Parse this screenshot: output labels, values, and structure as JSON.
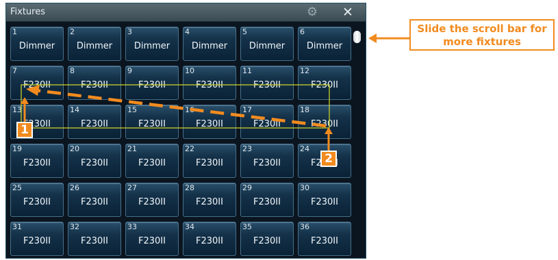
{
  "window": {
    "title": "Fixtures"
  },
  "fixtures": [
    {
      "num": "1",
      "label": "Dimmer"
    },
    {
      "num": "2",
      "label": "Dimmer"
    },
    {
      "num": "3",
      "label": "Dimmer"
    },
    {
      "num": "4",
      "label": "Dimmer"
    },
    {
      "num": "5",
      "label": "Dimmer"
    },
    {
      "num": "6",
      "label": "Dimmer"
    },
    {
      "num": "7",
      "label": "F230II"
    },
    {
      "num": "8",
      "label": "F230II"
    },
    {
      "num": "9",
      "label": "F230II"
    },
    {
      "num": "10",
      "label": "F230II"
    },
    {
      "num": "11",
      "label": "F230II"
    },
    {
      "num": "12",
      "label": "F230II"
    },
    {
      "num": "13",
      "label": "F230II"
    },
    {
      "num": "14",
      "label": "F230II"
    },
    {
      "num": "15",
      "label": "F230II"
    },
    {
      "num": "16",
      "label": "F230II"
    },
    {
      "num": "17",
      "label": "F230II"
    },
    {
      "num": "18",
      "label": "F230II"
    },
    {
      "num": "19",
      "label": "F230II"
    },
    {
      "num": "20",
      "label": "F230II"
    },
    {
      "num": "21",
      "label": "F230II"
    },
    {
      "num": "22",
      "label": "F230II"
    },
    {
      "num": "23",
      "label": "F230II"
    },
    {
      "num": "24",
      "label": "F230II"
    },
    {
      "num": "25",
      "label": "F230II"
    },
    {
      "num": "26",
      "label": "F230II"
    },
    {
      "num": "27",
      "label": "F230II"
    },
    {
      "num": "28",
      "label": "F230II"
    },
    {
      "num": "29",
      "label": "F230II"
    },
    {
      "num": "30",
      "label": "F230II"
    },
    {
      "num": "31",
      "label": "F230II"
    },
    {
      "num": "32",
      "label": "F230II"
    },
    {
      "num": "33",
      "label": "F230II"
    },
    {
      "num": "34",
      "label": "F230II"
    },
    {
      "num": "35",
      "label": "F230II"
    },
    {
      "num": "36",
      "label": "F230II"
    }
  ],
  "annotations": {
    "callout_text": "Slide the scroll bar for more fixtures",
    "step1": "1",
    "step2": "2"
  },
  "icons": {
    "settings": "gear-icon",
    "close": "close-icon"
  },
  "colors": {
    "accent": "#f28b1f",
    "selection_box": "#c9cf2a",
    "tile_border": "#46708a"
  }
}
